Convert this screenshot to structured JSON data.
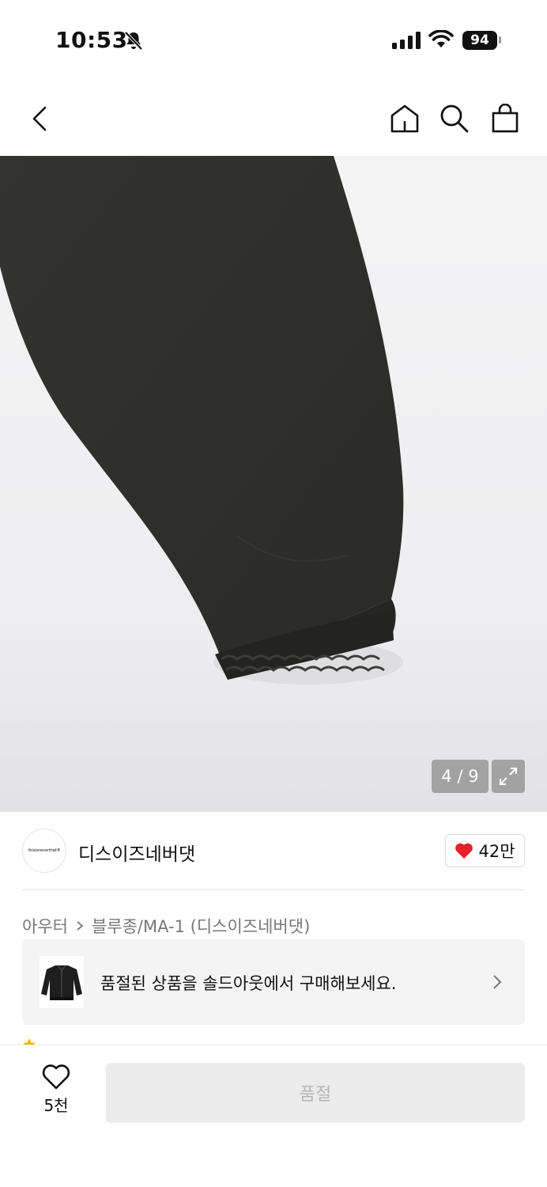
{
  "status_bar": {
    "time": "10:53",
    "battery": "94"
  },
  "product": {
    "image_counter": "4 / 9"
  },
  "brand": {
    "logo_text": "thisisneverthat®",
    "name": "디스이즈네버댓",
    "like_count": "42만"
  },
  "breadcrumb": {
    "category": "아우터",
    "subcategory": "블루종/MA-1 (디스이즈네버댓)"
  },
  "soldout_banner": {
    "text": "품절된 상품을 솔드아웃에서 구매해보세요."
  },
  "bottom_bar": {
    "wish_count": "5천",
    "buy_label": "품절"
  },
  "colors": {
    "like_heart": "#e8202a",
    "garment": "#2f2f2c",
    "buy_disabled_bg": "#ececec",
    "buy_disabled_text": "#b5b5b5"
  }
}
